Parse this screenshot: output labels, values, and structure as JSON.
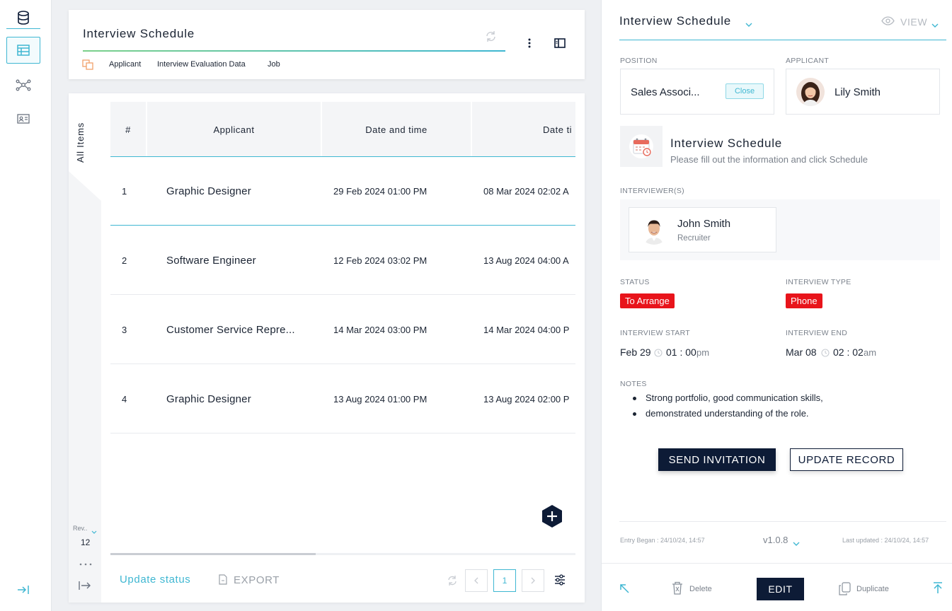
{
  "rail": {
    "icons": [
      "database-icon",
      "table-icon",
      "network-icon",
      "contact-card-icon",
      "collapse-right-icon"
    ]
  },
  "header": {
    "title": "Interview Schedule",
    "links": [
      "Applicant",
      "Interview Evaluation Data",
      "Job"
    ]
  },
  "table": {
    "side_tab": "All Items",
    "columns": [
      "#",
      "Applicant",
      "Date and time",
      "Date ti"
    ],
    "rows": [
      {
        "num": "1",
        "applicant": "Graphic Designer",
        "date1": "29 Feb 2024 01:00 PM",
        "date2": "08 Mar 2024 02:02 A"
      },
      {
        "num": "2",
        "applicant": "Software Engineer",
        "date1": "12 Feb 2024 03:02 PM",
        "date2": "13 Aug 2024 04:00 A"
      },
      {
        "num": "3",
        "applicant": "Customer Service Repre...",
        "date1": "14 Mar 2024 03:00 PM",
        "date2": "14 Mar 2024 04:00 P"
      },
      {
        "num": "4",
        "applicant": "Graphic Designer",
        "date1": "13 Aug 2024 01:00 PM",
        "date2": "13 Aug 2024 02:00 P"
      }
    ],
    "rev_label": "Rev..",
    "rev_count": "12",
    "footer": {
      "update_status": "Update status",
      "export": "EXPORT",
      "page": "1"
    }
  },
  "panel": {
    "title": "Interview Schedule",
    "view_label": "VIEW",
    "position_label": "POSITION",
    "position_value": "Sales Associ...",
    "close_label": "Close",
    "applicant_label": "APPLICANT",
    "applicant_name": "Lily Smith",
    "schedule_title": "Interview Schedule",
    "schedule_subtitle": "Please fill out the information and click Schedule",
    "interviewers_label": "INTERVIEWER(S)",
    "interviewer_name": "John Smith",
    "interviewer_role": "Recruiter",
    "status_label": "STATUS",
    "status_value": "To Arrange",
    "type_label": "INTERVIEW TYPE",
    "type_value": "Phone",
    "start_label": "INTERVIEW START",
    "start_date": "Feb 29",
    "start_time": "01 : 00",
    "start_ampm": "pm",
    "end_label": "INTERVIEW END",
    "end_date": "Mar 08",
    "end_time": "02 : 02",
    "end_ampm": "am",
    "notes_label": "NOTES",
    "notes": [
      "Strong portfolio, good communication skills,",
      "demonstrated understanding of the role."
    ],
    "send_button": "SEND INVITATION",
    "update_button": "UPDATE RECORD",
    "entry_began": "Entry Began : 24/10/24, 14:57",
    "version": "v1.0.8",
    "last_updated": "Last updated : 24/10/24, 14:57",
    "delete_label": "Delete",
    "edit_label": "EDIT",
    "duplicate_label": "Duplicate"
  },
  "colors": {
    "accent": "#3fb7d2",
    "navy": "#0d1b36",
    "red": "#e8141b",
    "green_link": "#7bd08a"
  }
}
